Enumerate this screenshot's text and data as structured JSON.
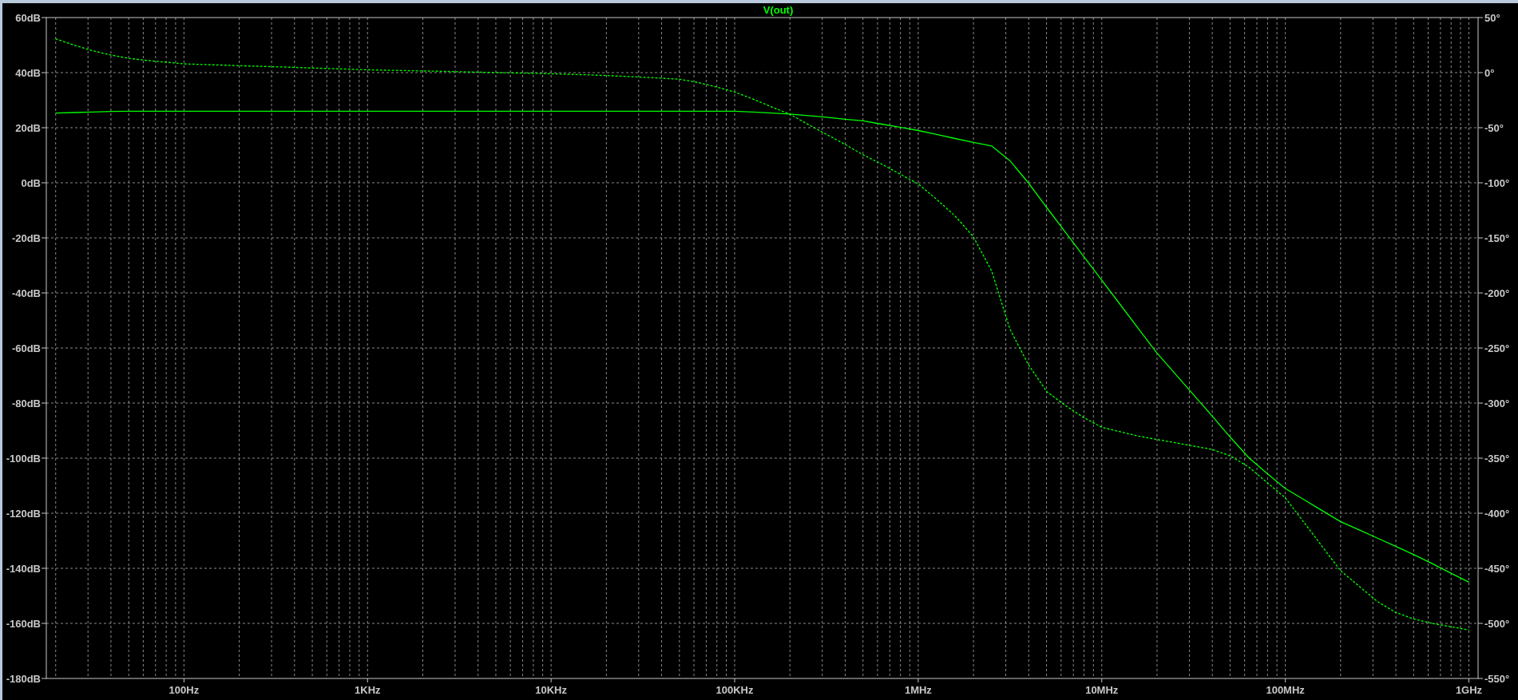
{
  "plot": {
    "chart_data": {
      "type": "line",
      "title": "V(out)",
      "categories": [
        null,
        null,
        null,
        null,
        null,
        null,
        null,
        "100Hz",
        null,
        null,
        null,
        null,
        null,
        null,
        null,
        null,
        null,
        "1KHz",
        null,
        null,
        null,
        null,
        null,
        null,
        null,
        null,
        null,
        "10KHz",
        null,
        null,
        null,
        null,
        null,
        null,
        null,
        null,
        null,
        "100KHz",
        null,
        null,
        null,
        null,
        null,
        null,
        null,
        null,
        null,
        "1MHz",
        null,
        null,
        null,
        null,
        null,
        null,
        null,
        null,
        null,
        "10MHz",
        null,
        null,
        null,
        null,
        null,
        null,
        null,
        null,
        null,
        "100MHz",
        null,
        null,
        null,
        null,
        null,
        null,
        null,
        null,
        null,
        "1GHz"
      ],
      "series": [
        {
          "color": "#00ff00",
          "values": [
            25.3,
            25.5,
            25.7,
            25.9,
            26,
            26,
            26,
            26,
            26,
            26,
            26,
            26,
            26,
            26,
            26,
            26,
            26,
            26,
            26,
            26,
            26,
            26,
            26,
            26,
            26,
            26,
            26,
            26,
            26,
            26,
            26,
            26,
            26,
            26,
            26,
            26,
            26,
            26,
            25.7,
            25.3,
            25,
            24.4,
            23.8,
            23.1,
            22.5,
            21.3,
            20.2,
            19,
            17.6,
            16.1,
            14.7,
            13.4,
            8,
            0,
            -9,
            -17.8,
            -26.6,
            -35.4,
            -44.2,
            -53,
            -61.8,
            -69.4,
            -77,
            -84.6,
            -92.4,
            -99.8,
            -105.5,
            -111,
            -115,
            -119,
            -123,
            -126,
            -129,
            -132,
            -135,
            -138.3,
            -141.7,
            -145
          ]
        },
        {
          "axis": "y2",
          "line_style": "dashed",
          "color": "#00ff00",
          "values": [
            30.7,
            25,
            20,
            16,
            13,
            11,
            9.5,
            8,
            7.4,
            6.9,
            6.3,
            5.8,
            5.3,
            4.8,
            4.2,
            3.7,
            3.1,
            2.6,
            2.2,
            1.9,
            1.5,
            1.2,
            0.8,
            0.4,
            0.1,
            -0.3,
            -0.6,
            -1,
            -1.5,
            -2,
            -2.6,
            -3.3,
            -4.2,
            -5,
            -6,
            -9,
            -13,
            -17.5,
            -24,
            -31,
            -37.7,
            -47,
            -56,
            -65,
            -74.6,
            -83,
            -92,
            -101,
            -115,
            -130,
            -149,
            -180,
            -233,
            -265,
            -289.5,
            -302,
            -313,
            -322,
            -326,
            -330,
            -333,
            -336,
            -339,
            -342,
            -348,
            -358,
            -372,
            -386,
            -408,
            -430,
            -452,
            -466,
            -480,
            -490,
            -496,
            -500,
            -503,
            -506
          ]
        }
      ],
      "grid": true,
      "ylim": [
        -180,
        60
      ],
      "y2lim": [
        -550,
        50
      ],
      "yticks": [
        {
          "value": 60,
          "label": "60dB"
        },
        {
          "value": 40,
          "label": "40dB"
        },
        {
          "value": 20,
          "label": "20dB"
        },
        {
          "value": 0,
          "label": "0dB"
        },
        {
          "value": -20,
          "label": "-20dB"
        },
        {
          "value": -40,
          "label": "-40dB"
        },
        {
          "value": -60,
          "label": "-60dB"
        },
        {
          "value": -80,
          "label": "-80dB"
        },
        {
          "value": -100,
          "label": "-100dB"
        },
        {
          "value": -120,
          "label": "-120dB"
        },
        {
          "value": -140,
          "label": "-140dB"
        },
        {
          "value": -160,
          "label": "-160dB"
        },
        {
          "value": -180,
          "label": "-180dB"
        }
      ],
      "y2ticks": [
        {
          "value": 50,
          "label": "50°"
        },
        {
          "value": 0,
          "label": "0°"
        },
        {
          "value": -50,
          "label": "-50°"
        },
        {
          "value": -100,
          "label": "-100°"
        },
        {
          "value": -150,
          "label": "-150°"
        },
        {
          "value": -200,
          "label": "-200°"
        },
        {
          "value": -250,
          "label": "-250°"
        },
        {
          "value": -300,
          "label": "-300°"
        },
        {
          "value": -350,
          "label": "-350°"
        },
        {
          "value": -400,
          "label": "-400°"
        },
        {
          "value": -450,
          "label": "-450°"
        },
        {
          "value": -500,
          "label": "-500°"
        },
        {
          "value": -550,
          "label": "-550°"
        }
      ]
    }
  }
}
